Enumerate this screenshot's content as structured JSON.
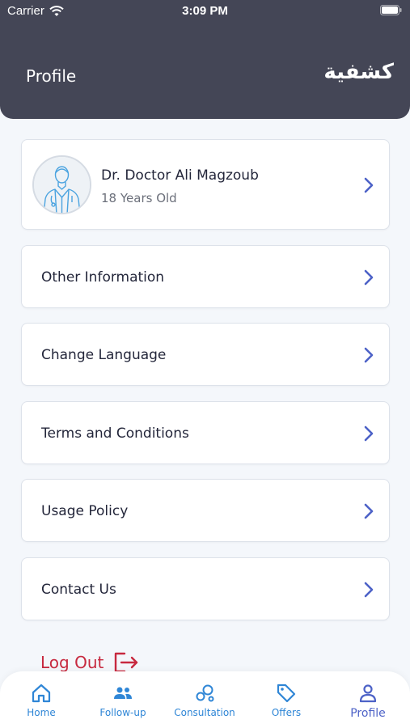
{
  "status_bar": {
    "carrier": "Carrier",
    "time": "3:09 PM"
  },
  "header": {
    "title": "Profile",
    "logo_text": "كشفية"
  },
  "profile": {
    "name": "Dr. Doctor Ali Magzoub",
    "age": "18 Years Old"
  },
  "menu": [
    {
      "label": "Other Information"
    },
    {
      "label": "Change Language"
    },
    {
      "label": "Terms and Conditions"
    },
    {
      "label": "Usage Policy"
    },
    {
      "label": "Contact Us"
    }
  ],
  "logout": {
    "label": "Log Out"
  },
  "tabs": [
    {
      "label": "Home",
      "icon": "home-icon"
    },
    {
      "label": "Follow-up",
      "icon": "users-icon"
    },
    {
      "label": "Consultation",
      "icon": "consultation-icon"
    },
    {
      "label": "Offers",
      "icon": "tag-icon"
    },
    {
      "label": "Profile",
      "icon": "person-icon",
      "active": true
    }
  ],
  "colors": {
    "header_bg": "#444656",
    "accent": "#4d62c7",
    "tab_blue": "#2f86d6",
    "logout_red": "#c7293f"
  }
}
